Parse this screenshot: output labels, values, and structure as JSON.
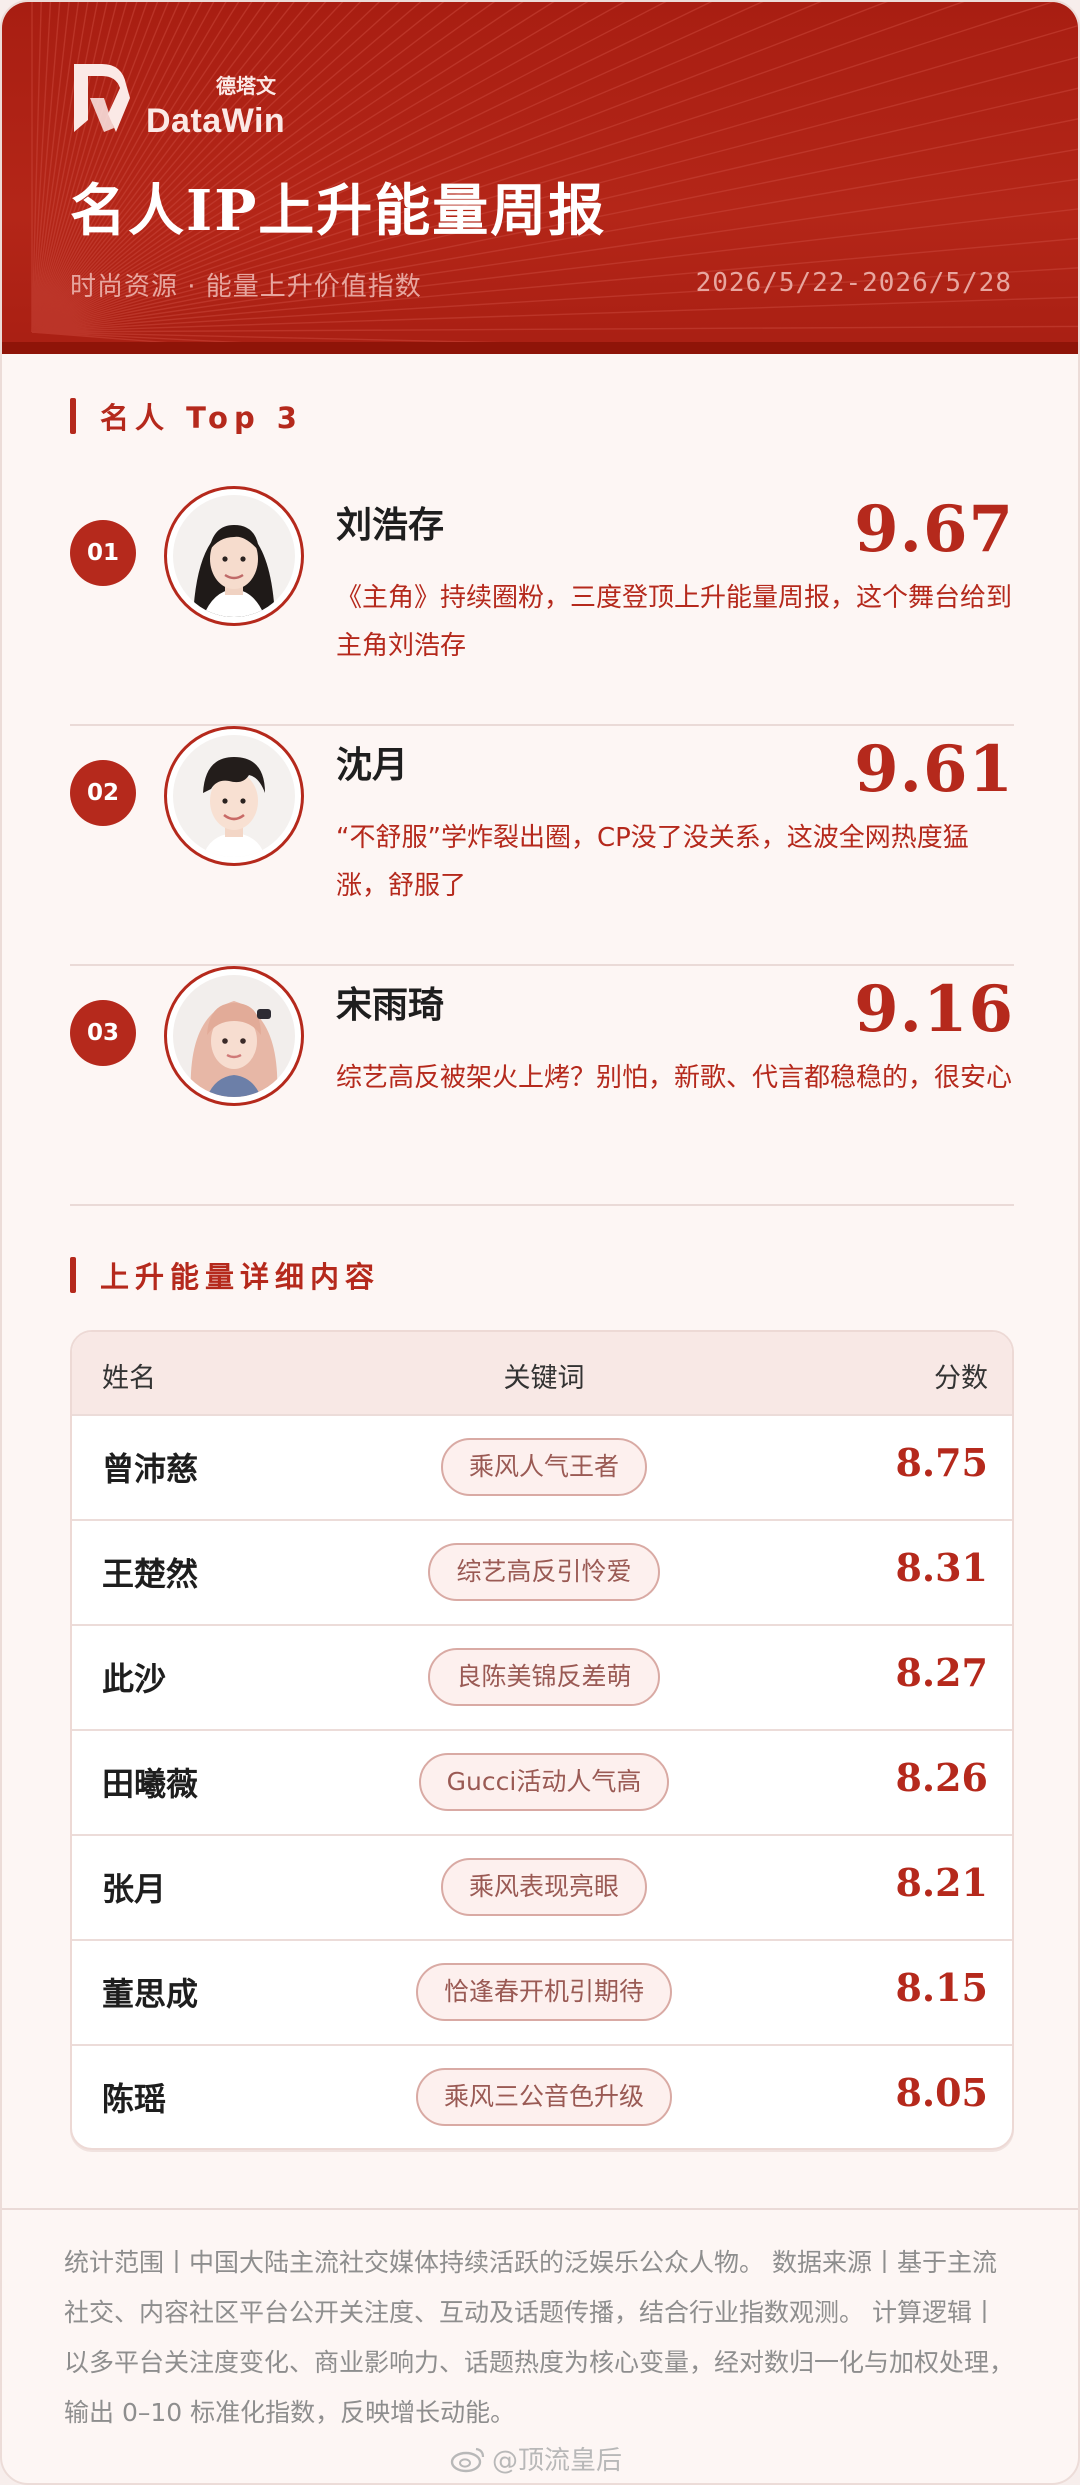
{
  "header": {
    "logo_text": "DataWin",
    "logo_cn": "德塔文",
    "title": "名人IP上升能量周报",
    "subtitle": "时尚资源 · 能量上升价值指数",
    "date_range": "2026/5/22-2026/5/28"
  },
  "top3": {
    "heading": "名人 Top 3",
    "items": [
      {
        "rank": "01",
        "name": "刘浩存",
        "score": "9.67",
        "desc": "《主角》持续圈粉，三度登顶上升能量周报，这个舞台给到主角刘浩存"
      },
      {
        "rank": "02",
        "name": "沈月",
        "score": "9.61",
        "desc": "“不舒服”学炸裂出圈，CP没了没关系，这波全网热度猛涨，舒服了"
      },
      {
        "rank": "03",
        "name": "宋雨琦",
        "score": "9.16",
        "desc": "综艺高反被架火上烤？别怕，新歌、代言都稳稳的，很安心"
      }
    ]
  },
  "details": {
    "heading": "上升能量详细内容",
    "columns": {
      "name": "姓名",
      "keyword": "关键词",
      "score": "分数"
    },
    "rows": [
      {
        "name": "曾沛慈",
        "keyword": "乘风人气王者",
        "score": "8.75"
      },
      {
        "name": "王楚然",
        "keyword": "综艺高反引怜爱",
        "score": "8.31"
      },
      {
        "name": "此沙",
        "keyword": "良陈美锦反差萌",
        "score": "8.27"
      },
      {
        "name": "田曦薇",
        "keyword": "Gucci活动人气高",
        "score": "8.26"
      },
      {
        "name": "张月",
        "keyword": "乘风表现亮眼",
        "score": "8.21"
      },
      {
        "name": "董思成",
        "keyword": "恰逢春开机引期待",
        "score": "8.15"
      },
      {
        "name": "陈瑶",
        "keyword": "乘风三公音色升级",
        "score": "8.05"
      }
    ]
  },
  "footer": {
    "note": "统计范围丨中国大陆主流社交媒体持续活跃的泛娱乐公众人物。 数据来源丨基于主流社交、内容社区平台公开关注度、互动及话题传播，结合行业指数观测。 计算逻辑丨以多平台关注度变化、商业影响力、话题热度为核心变量，经对数归一化与加权处理，输出 0–10 标准化指数，反映增长动能。",
    "watermark": "@顶流皇后"
  },
  "colors": {
    "brand_red": "#b5291c",
    "header_red": "#a81e12"
  }
}
